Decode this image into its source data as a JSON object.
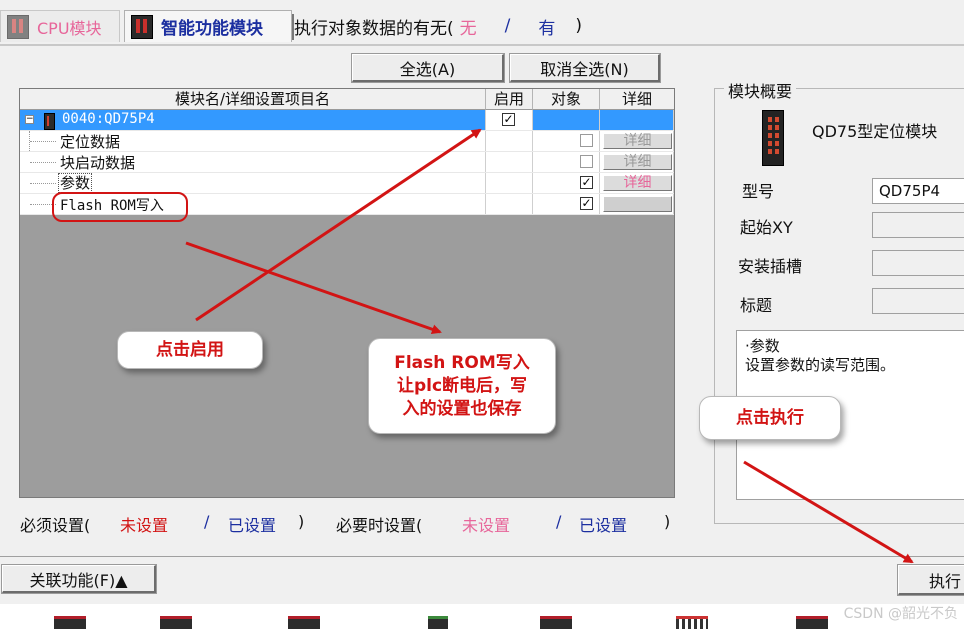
{
  "tabs": [
    {
      "label": "CPU模块",
      "active": false
    },
    {
      "label": "智能功能模块",
      "active": true
    }
  ],
  "exec_header": {
    "label": "执行对象数据的有无(",
    "none": "无",
    "sep": "/",
    "has": "有",
    "close": ")"
  },
  "buttons": {
    "select_all": "全选(A)",
    "deselect_all": "取消全选(N)",
    "related": "关联功能(F)▲",
    "execute": "执行"
  },
  "table": {
    "headers": [
      "模块名/详细设置项目名",
      "启用",
      "对象",
      "详细"
    ],
    "rows": [
      {
        "name": "0040:QD75P4",
        "enabled": true,
        "target": null,
        "detail": "",
        "selected": true
      },
      {
        "name": "定位数据",
        "enabled": null,
        "target": false,
        "detail": "详细"
      },
      {
        "name": "块启动数据",
        "enabled": null,
        "target": false,
        "detail": "详细"
      },
      {
        "name": "参数",
        "enabled": null,
        "target": true,
        "detail": "详细"
      },
      {
        "name": "Flash ROM写入",
        "enabled": null,
        "target": true,
        "detail": ""
      }
    ]
  },
  "status": {
    "required_label": "必须设置(",
    "not_set": "未设置",
    "slash": "/",
    "set": "已设置",
    "close": ")",
    "optional_label": "必要时设置(",
    "opt_not_set": "未设置",
    "opt_slash": "/",
    "opt_set": "已设置",
    "opt_close": ")"
  },
  "overview": {
    "title": "模块概要",
    "module_type": "QD75型定位模块",
    "fields": [
      {
        "label": "型号",
        "value": "QD75P4"
      },
      {
        "label": "起始XY",
        "value": ""
      },
      {
        "label": "安装插槽",
        "value": ""
      },
      {
        "label": "标题",
        "value": ""
      }
    ],
    "description_lines": [
      "·参数",
      "设置参数的读写范围。"
    ]
  },
  "annotations": {
    "click_enable": "点击启用",
    "flash_note_line1": "Flash ROM写入",
    "flash_note_line2": "让plc断电后，写",
    "flash_note_line3": "入的设置也保存",
    "click_execute": "点击执行"
  },
  "watermark": "CSDN @韶光不负",
  "colors": {
    "accent_red": "#d21414",
    "pink": "#e7669a",
    "blue": "#1c2fa0",
    "selection": "#3399ff"
  }
}
